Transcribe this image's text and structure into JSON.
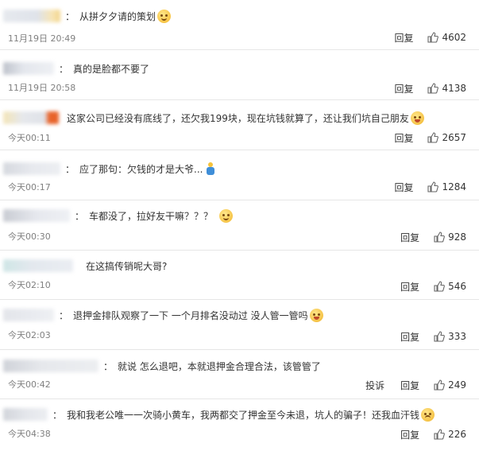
{
  "reply_label": "回复",
  "report_label": "投诉",
  "comments": [
    {
      "text": "从拼夕夕请的策划",
      "time": "11月19日 20:49",
      "likes": "4602",
      "emoji": "think-face"
    },
    {
      "text": "真的是脸都不要了",
      "time": "11月19日 20:58",
      "likes": "4138"
    },
    {
      "text": "这家公司已经没有底线了，还欠我199块，现在坑钱就算了，还让我们坑自己朋友",
      "time": "今天00:11",
      "likes": "2657",
      "emoji": "laugh-cry-face"
    },
    {
      "text": "应了那句：欠钱的才是大爷...",
      "time": "今天00:17",
      "likes": "1284",
      "emoji": "figure"
    },
    {
      "text": "车都没了，拉好友干嘛？？？",
      "time": "今天00:30",
      "likes": "928",
      "emoji": "sleepy-face"
    },
    {
      "text": "在这搞传销呢大哥?",
      "time": "今天02:10",
      "likes": "546"
    },
    {
      "text": "退押金排队观察了一下 一个月排名没动过 没人管一管吗",
      "time": "今天02:03",
      "likes": "333",
      "emoji": "laugh-cry-face"
    },
    {
      "text": "就说 怎么退吧，本就退押金合理合法，该管管了",
      "time": "今天00:42",
      "likes": "249",
      "has_report": true
    },
    {
      "text": "我和我老公唯一一次骑小黄车，我两都交了押金至今未退，坑人的骗子！还我血汗钱",
      "time": "今天04:38",
      "likes": "226",
      "emoji": "sad-face"
    }
  ],
  "colors": {
    "text": "#333333",
    "time": "#808080",
    "separator": "#e6e6e6",
    "accent_orange": "#e8632a"
  }
}
